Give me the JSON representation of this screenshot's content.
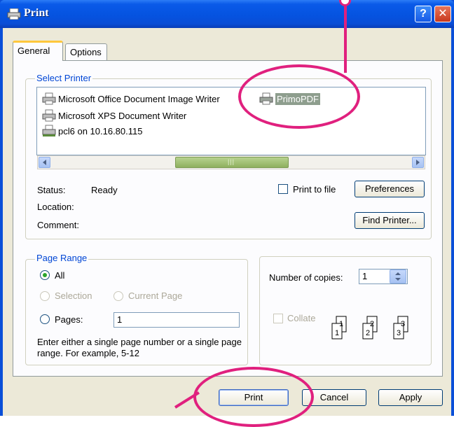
{
  "window": {
    "title": "Print"
  },
  "tabs": [
    {
      "label": "General"
    },
    {
      "label": "Options"
    }
  ],
  "select_printer": {
    "legend": "Select Printer",
    "printers": [
      "Microsoft Office Document Image Writer",
      "Microsoft XPS Document Writer",
      "pcl6 on 10.16.80.115",
      "PrimoPDF"
    ],
    "selected": "PrimoPDF",
    "status_label": "Status:",
    "status_value": "Ready",
    "location_label": "Location:",
    "comment_label": "Comment:",
    "print_to_file_label": "Print to file",
    "preferences_label": "Preferences",
    "find_printer_label": "Find Printer..."
  },
  "page_range": {
    "legend": "Page Range",
    "all_label": "All",
    "selection_label": "Selection",
    "current_page_label": "Current Page",
    "pages_label": "Pages:",
    "pages_value": "1",
    "hint": "Enter either a single page number or a single page range.  For example, 5-12"
  },
  "copies": {
    "number_label": "Number of copies:",
    "number_value": "1",
    "collate_label": "Collate",
    "collate_digits": [
      "1",
      "1",
      "2",
      "2",
      "3",
      "3"
    ]
  },
  "buttons": {
    "print": "Print",
    "cancel": "Cancel",
    "apply": "Apply"
  },
  "colors": {
    "accent_annotation": "#e0207e",
    "titlebar": "#0553e0",
    "dialog_bg": "#ece9d8"
  }
}
